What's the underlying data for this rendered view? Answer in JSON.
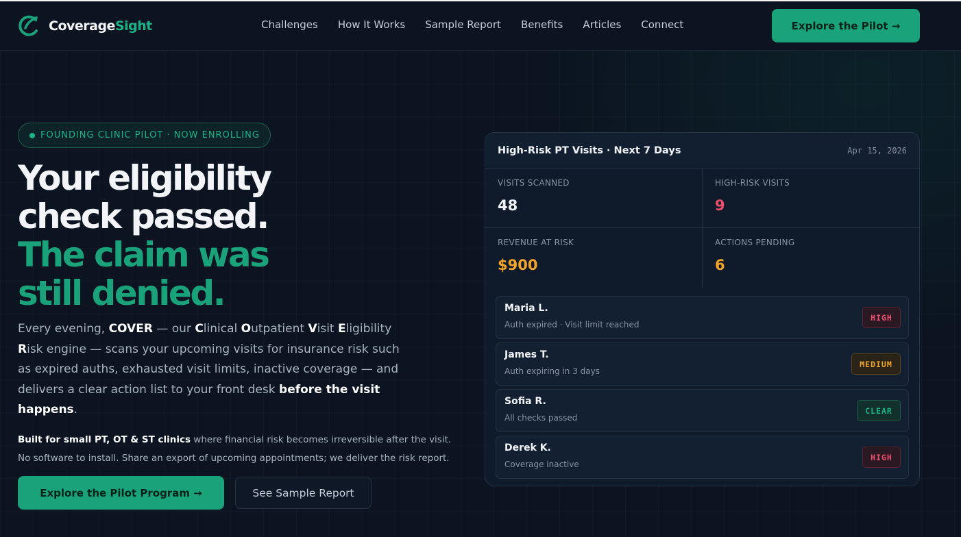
{
  "brand": {
    "part1": "Coverage",
    "part2": "Sight"
  },
  "nav": {
    "links": [
      "Challenges",
      "How It Works",
      "Sample Report",
      "Benefits",
      "Articles",
      "Connect"
    ],
    "cta": "Explore the Pilot →"
  },
  "hero": {
    "badge": "FOUNDING CLINIC PILOT · NOW ENROLLING",
    "headline_white": [
      "Your eligibility",
      "check passed."
    ],
    "headline_green": [
      "The claim was",
      "still denied."
    ],
    "desc": {
      "p1": "Every evening, ",
      "cover": "COVER",
      "p2": " — our ",
      "c": "C",
      "linical": "linical ",
      "o": "O",
      "utpatient": "utpatient ",
      "v": "V",
      "isit": "isit ",
      "e": "E",
      "ligibility": "ligibility",
      "r": "R",
      "isk": "isk engine — scans your upcoming visits for insurance risk such as expired auths, exhausted visit limits, inactive coverage — and delivers a clear action list to your front desk ",
      "bold_end": "before the visit happens",
      "period": "."
    },
    "note": {
      "bold": "Built for small PT, OT & ST clinics",
      "rest": " where financial risk becomes irreversible after the visit.",
      "line2": "No software to install. Share an export of upcoming appointments; we deliver the risk report."
    },
    "primary_button": "Explore the Pilot Program →",
    "secondary_button": "See Sample Report"
  },
  "report": {
    "title": "High-Risk PT Visits · Next 7 Days",
    "date": "Apr 15, 2026",
    "stats": [
      {
        "label": "VISITS SCANNED",
        "value": "48",
        "color": "#f2f4f7"
      },
      {
        "label": "HIGH-RISK VISITS",
        "value": "9",
        "color": "#f0506e"
      },
      {
        "label": "REVENUE AT RISK",
        "value": "$900",
        "color": "#f2a52a"
      },
      {
        "label": "ACTIONS PENDING",
        "value": "6",
        "color": "#f2a52a"
      }
    ],
    "patients": [
      {
        "name": "Maria L.",
        "detail": "Auth expired · Visit limit reached",
        "status": "HIGH"
      },
      {
        "name": "James T.",
        "detail": "Auth expiring in 3 days",
        "status": "MEDIUM"
      },
      {
        "name": "Sofia R.",
        "detail": "All checks passed",
        "status": "CLEAR"
      },
      {
        "name": "Derek K.",
        "detail": "Coverage inactive",
        "status": "HIGH"
      }
    ]
  },
  "colors": {
    "accent": "#1aa37a",
    "high": "#f0506e",
    "medium": "#f2a52a",
    "clear": "#1db385",
    "background": "#0b1420"
  }
}
